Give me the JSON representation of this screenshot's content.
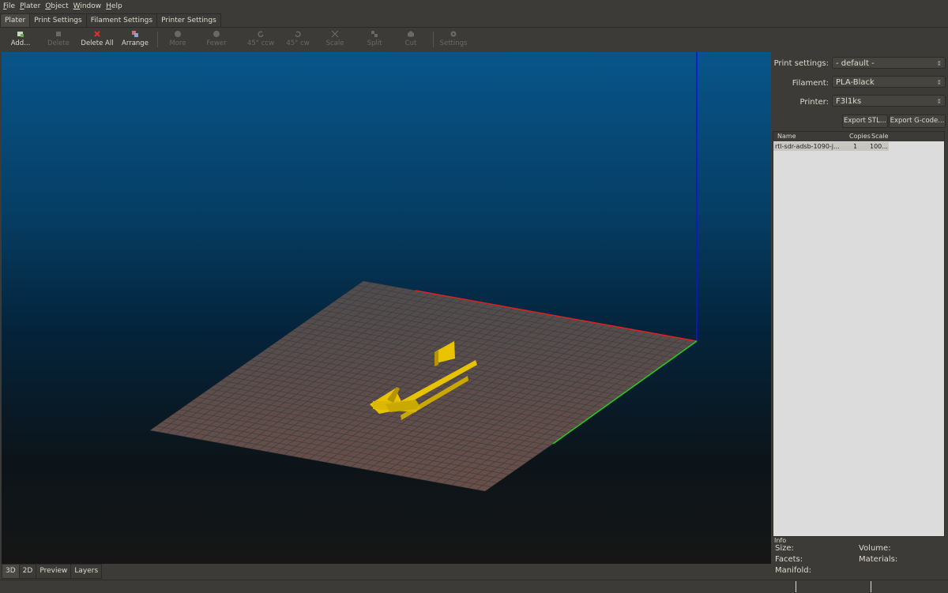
{
  "menu": [
    {
      "key": "F",
      "rest": "ile"
    },
    {
      "key": "P",
      "rest": "later"
    },
    {
      "key": "O",
      "rest": "bject"
    },
    {
      "key": "W",
      "rest": "indow"
    },
    {
      "key": "H",
      "rest": "elp"
    }
  ],
  "tabs": [
    "Plater",
    "Print Settings",
    "Filament Settings",
    "Printer Settings"
  ],
  "toolbar": {
    "add": "Add...",
    "delete": "Delete",
    "delete_all": "Delete All",
    "arrange": "Arrange",
    "more": "More",
    "fewer": "Fewer",
    "rot_ccw": "45° ccw",
    "rot_cw": "45° cw",
    "scale": "Scale",
    "split": "Split",
    "cut": "Cut",
    "settings": "Settings"
  },
  "view_tabs": [
    "3D",
    "2D",
    "Preview",
    "Layers"
  ],
  "panel": {
    "print_settings_label": "Print settings:",
    "print_settings_value": "- default -",
    "filament_label": "Filament:",
    "filament_value": "PLA-Black",
    "printer_label": "Printer:",
    "printer_value": "F3l1ks",
    "export_stl": "Export STL...",
    "export_gcode": "Export G-code..."
  },
  "object_list": {
    "col_name": "Name",
    "col_copies": "Copies",
    "col_scale": "Scale",
    "rows": [
      {
        "name": "rtl-sdr-adsb-1090-j...",
        "copies": "1",
        "scale": "100..."
      }
    ]
  },
  "info": {
    "title": "Info",
    "size": "Size:",
    "volume": "Volume:",
    "facets": "Facets:",
    "materials": "Materials:",
    "manifold": "Manifold:"
  },
  "colors": {
    "axis_x": "#e02020",
    "axis_y": "#20d020",
    "axis_z": "#1010e8",
    "bed": "#5a5553",
    "model": "#e8c400"
  }
}
